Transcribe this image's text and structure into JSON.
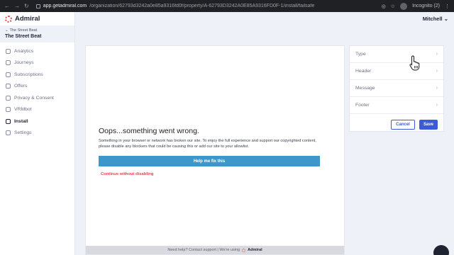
{
  "browser": {
    "url_host": "app.getadmiral.com",
    "url_path": "/organization/62793d3242a0e85a9316fd0f/property/A-62793D3242A0E85A9316FD0F-1/install/failsafe",
    "profile": "Incognito (2)"
  },
  "sidebar": {
    "logo": "Admiral",
    "property_small": "The Street Beat",
    "property_big": "The Street Beat",
    "items": [
      {
        "label": "Analytics",
        "icon": "house-icon"
      },
      {
        "label": "Journeys",
        "icon": "path-icon"
      },
      {
        "label": "Subscriptions",
        "icon": "tag-icon"
      },
      {
        "label": "Offers",
        "icon": "flag-icon"
      },
      {
        "label": "Privacy & Consent",
        "icon": "shield-icon"
      },
      {
        "label": "VRMbot",
        "icon": "chat-icon"
      },
      {
        "label": "Install",
        "icon": "code-icon",
        "active": true
      },
      {
        "label": "Settings",
        "icon": "gear-icon"
      }
    ]
  },
  "topbar": {
    "user": "Mitchell"
  },
  "preview": {
    "title": "Oops...something went wrong.",
    "body": "Something in your browser or network has broken our site. To enjoy the full experience and support our copyrighted content, please disable any blockers that could be causing this or add our site to your allowlist.",
    "fix_button": "Help me fix this",
    "continue_link": "Continue without disabling",
    "footer": "Need help? Contact support | We're using",
    "footer_brand": "Admiral"
  },
  "panel": {
    "sections": [
      "Type",
      "Header",
      "Message",
      "Footer"
    ],
    "cancel": "Cancel",
    "save": "Save"
  },
  "colors": {
    "accent": "#3b5bdb",
    "brand": "#e0464b",
    "fix_button": "#3c98c9"
  }
}
